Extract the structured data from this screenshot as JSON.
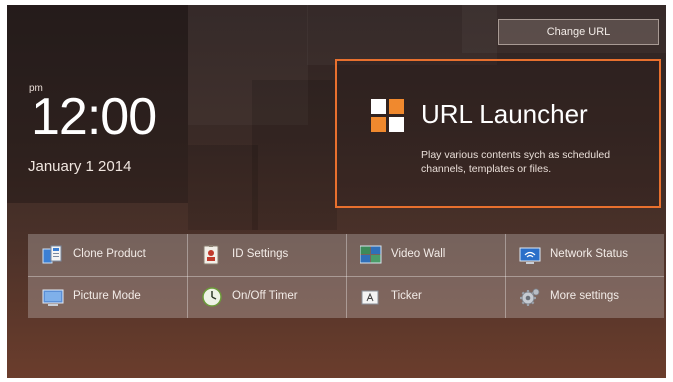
{
  "clock": {
    "ampm": "pm",
    "time": "12:00",
    "date": "January 1 2014"
  },
  "header": {
    "change_url_label": "Change URL"
  },
  "launcher": {
    "title": "URL Launcher",
    "description": "Play various contents sych as scheduled channels, templates or files.",
    "accent_color": "#e8702e"
  },
  "menu": {
    "items": [
      {
        "label": "Clone Product",
        "icon": "clone-product-icon"
      },
      {
        "label": "ID Settings",
        "icon": "id-settings-icon"
      },
      {
        "label": "Video Wall",
        "icon": "video-wall-icon"
      },
      {
        "label": "Network Status",
        "icon": "network-status-icon"
      },
      {
        "label": "Picture Mode",
        "icon": "picture-mode-icon"
      },
      {
        "label": "On/Off Timer",
        "icon": "on-off-timer-icon"
      },
      {
        "label": "Ticker",
        "icon": "ticker-icon"
      },
      {
        "label": "More settings",
        "icon": "gear-icon"
      }
    ]
  }
}
